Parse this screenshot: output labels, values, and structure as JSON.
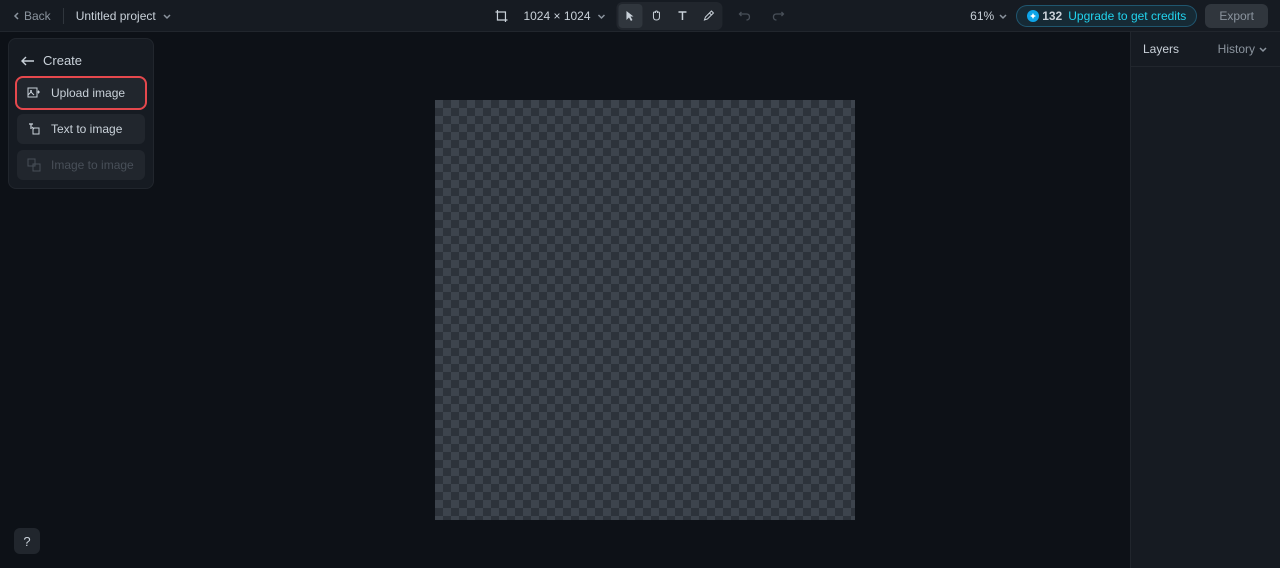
{
  "topbar": {
    "back_label": "Back",
    "project_title": "Untitled project",
    "canvas_size": "1024 × 1024",
    "zoom": "61%",
    "credits": "132",
    "upgrade_label": "Upgrade to get credits",
    "export_label": "Export"
  },
  "left_panel": {
    "header": "Create",
    "items": [
      {
        "label": "Upload image",
        "enabled": true,
        "highlighted": true
      },
      {
        "label": "Text to image",
        "enabled": true,
        "highlighted": false
      },
      {
        "label": "Image to image",
        "enabled": false,
        "highlighted": false
      }
    ]
  },
  "right_panel": {
    "layers_label": "Layers",
    "history_label": "History"
  },
  "help": "?"
}
